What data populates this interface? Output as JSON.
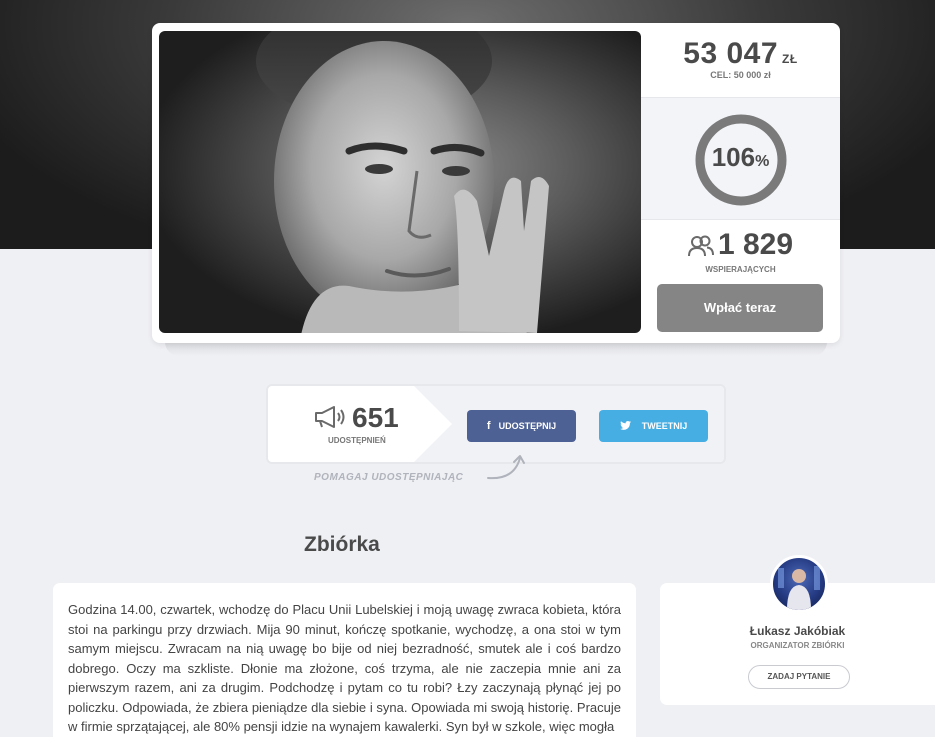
{
  "campaign": {
    "amount": "53 047",
    "currency": "ZŁ",
    "goal_label": "CEL: 50 000 zł",
    "progress_percent": 106,
    "progress_number": "106",
    "progress_sign": "%",
    "supporters_count": "1 829",
    "supporters_label": "WSPIERAJĄCYCH",
    "pay_button": "Wpłać teraz"
  },
  "share": {
    "count": "651",
    "count_label": "UDOSTĘPNIEŃ",
    "facebook_label": "UDOSTĘPNIJ",
    "twitter_label": "TWEETNIJ",
    "help_text": "POMAGAJ UDOSTĘPNIAJĄC"
  },
  "section": {
    "title": "Zbiórka"
  },
  "story": {
    "text": "Godzina 14.00, czwartek, wchodzę do Placu Unii Lubelskiej i moją uwagę zwraca kobieta, która stoi na parkingu przy drzwiach. Mija 90 minut, kończę spotkanie, wychodzę, a ona stoi w tym samym miejscu. Zwracam na nią uwagę bo bije od niej bezradność, smutek ale i coś bardzo dobrego. Oczy ma szkliste. Dłonie ma złożone, coś trzyma, ale nie zaczepia mnie ani za pierwszym razem, ani za drugim. Podchodzę i pytam co tu robi? Łzy zaczynają płynąć jej po policzku. Odpowiada, że zbiera pieniądze dla siebie i syna. Opowiada mi swoją historię. Pracuje w firmie sprzątającej, ale 80% pensji idzie na wynajem kawalerki. Syn był w szkole, więc mogła"
  },
  "organizer": {
    "name": "Łukasz Jakóbiak",
    "role": "ORGANIZATOR ZBIÓRKI",
    "ask_button": "ZADAJ PYTANIE"
  },
  "colors": {
    "page_bg": "#eff0f4",
    "pay_button": "#858585",
    "facebook": "#4e6194",
    "twitter": "#47aee3",
    "progress_ring": "#7a7a7a"
  },
  "icons": {
    "supporters": "users-icon",
    "share": "megaphone-icon",
    "facebook": "facebook-icon",
    "twitter": "twitter-icon"
  }
}
